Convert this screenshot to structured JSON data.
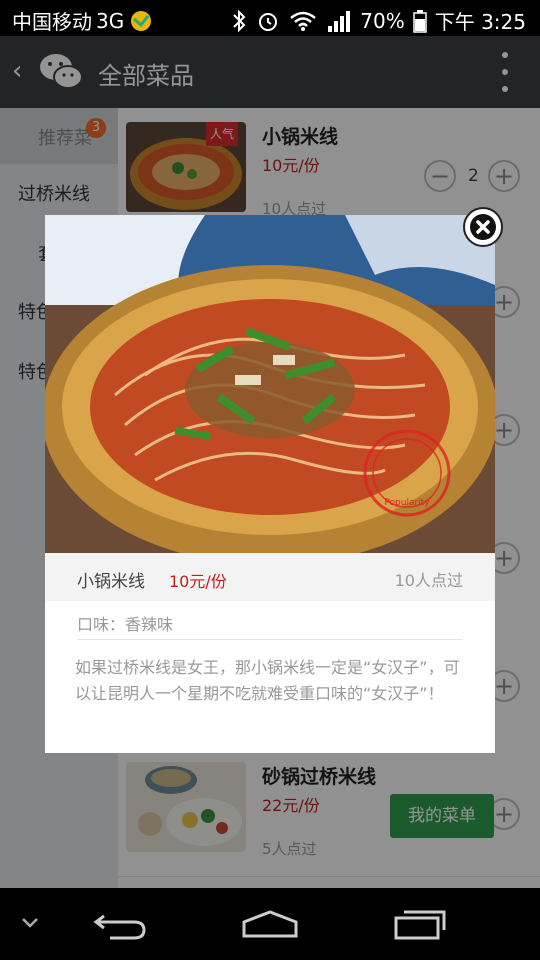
{
  "status_bar": {
    "carrier": "中国移动",
    "network": "3G",
    "battery": "70%",
    "time": "下午 3:25"
  },
  "app_bar": {
    "title": "全部菜品"
  },
  "sidebar": {
    "items": [
      {
        "label": "推荐菜",
        "badge": "3",
        "active": true
      },
      {
        "label": "过桥米线"
      },
      {
        "label": "套"
      },
      {
        "label": "特色"
      },
      {
        "label": "特色"
      }
    ]
  },
  "dishes": [
    {
      "name": "小锅米线",
      "price": "10元/份",
      "sold": "10人点过",
      "tag": "人气",
      "quantity": "2"
    },
    {
      "name": "砂锅过桥米线",
      "price": "22元/份",
      "sold": "5人点过"
    }
  ],
  "my_menu_label": "我的菜单",
  "modal": {
    "name": "小锅米线",
    "price": "10元/份",
    "sold": "10人点过",
    "taste": "口味：香辣味",
    "description": "如果过桥米线是女王，那小锅米线一定是“女汉子”，可以让昆明人一个星期不吃就难受重口味的“女汉子”！",
    "stamp_text": "Popularity"
  },
  "colors": {
    "accent_green": "#2f9b4e",
    "price_red": "#c0201b",
    "badge_orange": "#f36c2a"
  }
}
